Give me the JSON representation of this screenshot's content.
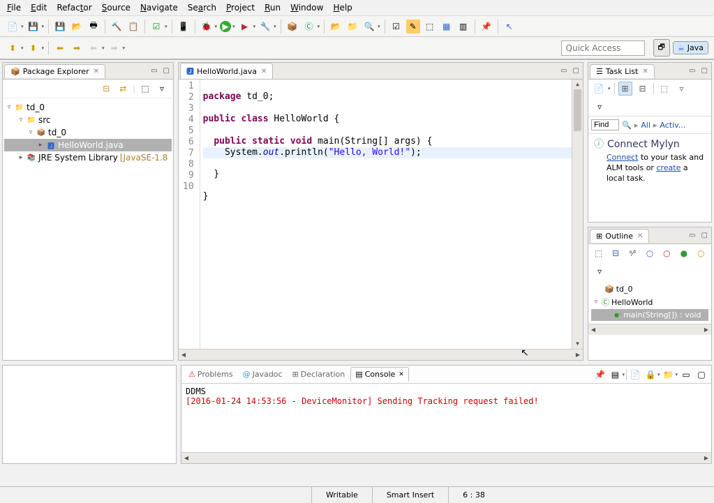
{
  "menu": {
    "file": "File",
    "edit": "Edit",
    "refactor": "Refactor",
    "source": "Source",
    "navigate": "Navigate",
    "search": "Search",
    "project": "Project",
    "run": "Run",
    "window": "Window",
    "help": "Help"
  },
  "quick_access_placeholder": "Quick Access",
  "perspective": {
    "java": "Java"
  },
  "package_explorer": {
    "title": "Package Explorer",
    "nodes": {
      "project": "td_0",
      "src": "src",
      "pkg": "td_0",
      "file": "HelloWorld.java",
      "jre": "JRE System Library",
      "jre_suffix": "[JavaSE-1.8"
    }
  },
  "editor": {
    "tab": "HelloWorld.java",
    "lines": [
      "1",
      "2",
      "3",
      "4",
      "5",
      "6",
      "7",
      "8",
      "9",
      "10"
    ],
    "code": {
      "l1a": "package",
      "l1b": " td_0;",
      "l3a": "public",
      "l3b": " ",
      "l3c": "class",
      "l3d": " HelloWorld {",
      "l5a": "  ",
      "l5b": "public",
      "l5c": " ",
      "l5d": "static",
      "l5e": " ",
      "l5f": "void",
      "l5g": " main(String[] args) {",
      "l6a": "    System.",
      "l6b": "out",
      "l6c": ".println(",
      "l6d": "\"Hello, World!\"",
      "l6e": ");",
      "l7": "  }",
      "l9": "}"
    }
  },
  "task_list": {
    "title": "Task List",
    "find": "Find",
    "all": "All",
    "activ": "Activ...",
    "mylyn_title": "Connect Mylyn",
    "mylyn_text1": "Connect",
    "mylyn_text2": " to your task and ALM tools or ",
    "mylyn_text3": "create",
    "mylyn_text4": " a local task."
  },
  "outline": {
    "title": "Outline",
    "pkg": "td_0",
    "class": "HelloWorld",
    "method": "main(String[]) : void"
  },
  "bottom_tabs": {
    "problems": "Problems",
    "javadoc": "Javadoc",
    "declaration": "Declaration",
    "console": "Console"
  },
  "console": {
    "title": "DDMS",
    "line": "[2016-01-24 14:53:56 - DeviceMonitor] Sending Tracking request failed!"
  },
  "status": {
    "writable": "Writable",
    "insert": "Smart Insert",
    "pos": "6 : 38"
  }
}
